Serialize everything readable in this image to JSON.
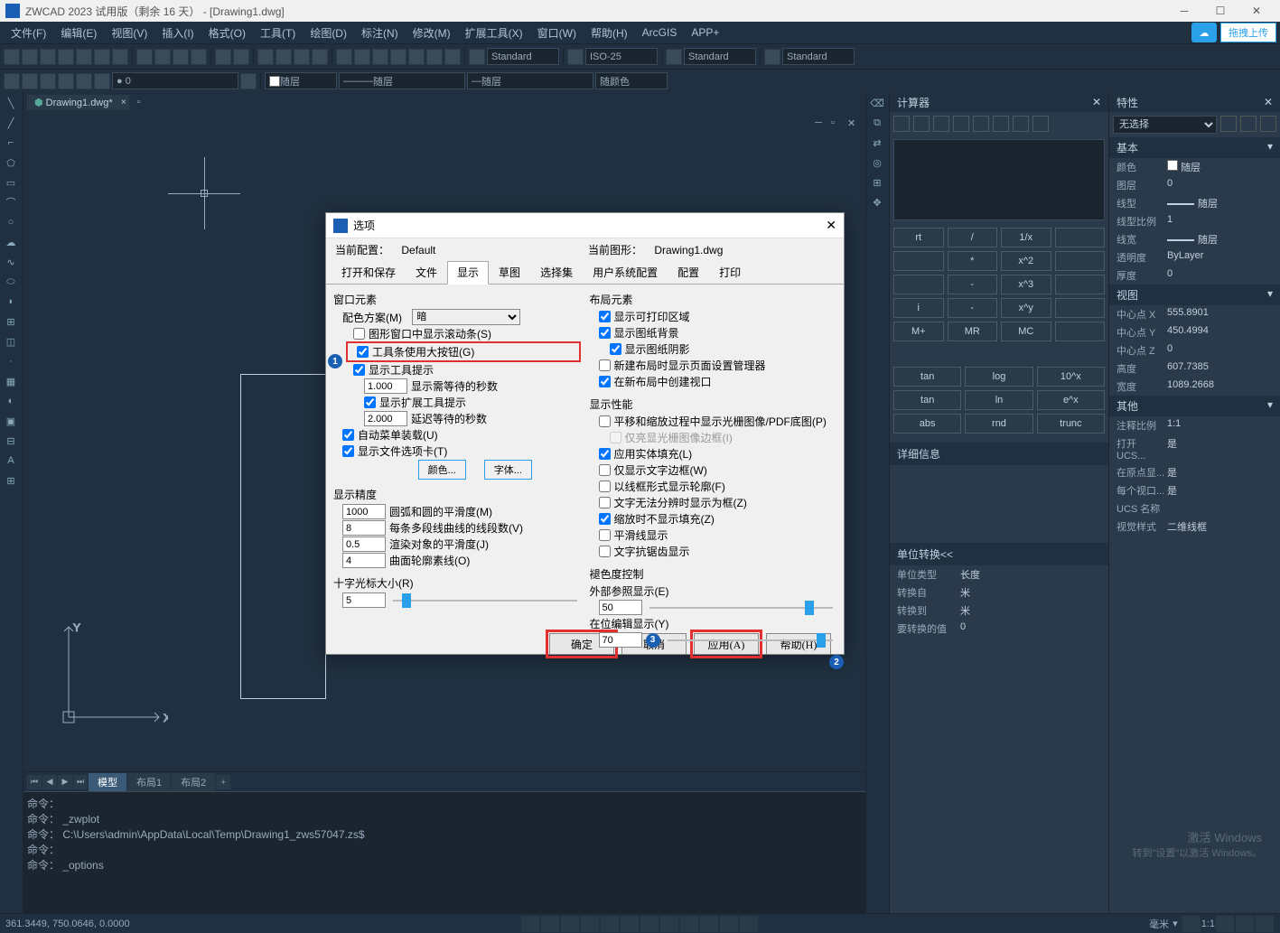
{
  "title": "ZWCAD 2023 试用版（剩余 16 天） - [Drawing1.dwg]",
  "menus": [
    "文件(F)",
    "编辑(E)",
    "视图(V)",
    "插入(I)",
    "格式(O)",
    "工具(T)",
    "绘图(D)",
    "标注(N)",
    "修改(M)",
    "扩展工具(X)",
    "窗口(W)",
    "帮助(H)",
    "ArcGIS",
    "APP+"
  ],
  "upload": {
    "label": "拖拽上传"
  },
  "toolbar": {
    "style1": "Standard",
    "style2": "ISO-25",
    "style3": "Standard",
    "style4": "Standard"
  },
  "layerbar": {
    "l1": "随层",
    "l2": "随层",
    "l3": "随层",
    "l4": "随颜色"
  },
  "docTab": "Drawing1.dwg*",
  "modelTabs": {
    "model": "模型",
    "layout1": "布局1",
    "layout2": "布局2"
  },
  "cmd": {
    "p": "命令：",
    "l1": "命令：",
    "l2": "命令： _zwplot",
    "l3": "命令： C:\\Users\\admin\\AppData\\Local\\Temp\\Drawing1_zws57047.zs$",
    "l4": "命令：",
    "l5": "命令： _options"
  },
  "calc": {
    "title": "计算器",
    "btns": [
      "rt",
      "/",
      "1/x",
      "",
      "",
      "x^2",
      "",
      "",
      "x^3",
      "i",
      "-",
      "x^y",
      "M+",
      "MR",
      "MC"
    ],
    "sci": [
      [
        "tan",
        "log",
        "10^x"
      ],
      [
        "tan",
        "ln",
        "e^x"
      ],
      [
        "abs",
        "rnd",
        "trunc"
      ]
    ],
    "detailTitle": "详细信息",
    "unitTitle": "单位转换<<",
    "unit": {
      "type": {
        "l": "单位类型",
        "v": "长度"
      },
      "from": {
        "l": "转换自",
        "v": "米"
      },
      "to": {
        "l": "转换到",
        "v": "米"
      },
      "val": {
        "l": "要转换的值",
        "v": "0"
      }
    }
  },
  "props": {
    "title": "特性",
    "sel": "无选择",
    "basic": {
      "title": "基本",
      "color": {
        "l": "颜色",
        "v": "随层"
      },
      "layer": {
        "l": "图层",
        "v": "0"
      },
      "ltype": {
        "l": "线型",
        "v": "随层"
      },
      "ltscale": {
        "l": "线型比例",
        "v": "1"
      },
      "lw": {
        "l": "线宽",
        "v": "随层"
      },
      "trans": {
        "l": "透明度",
        "v": "ByLayer"
      },
      "thick": {
        "l": "厚度",
        "v": "0"
      }
    },
    "view": {
      "title": "视图",
      "cx": {
        "l": "中心点 X",
        "v": "555.8901"
      },
      "cy": {
        "l": "中心点 Y",
        "v": "450.4994"
      },
      "cz": {
        "l": "中心点 Z",
        "v": "0"
      },
      "h": {
        "l": "高度",
        "v": "607.7385"
      },
      "w": {
        "l": "宽度",
        "v": "1089.2668"
      }
    },
    "other": {
      "title": "其他",
      "ann": {
        "l": "注释比例",
        "v": "1:1"
      },
      "ucs1": {
        "l": "打开 UCS...",
        "v": "是"
      },
      "ucs2": {
        "l": "在原点显...",
        "v": "是"
      },
      "ucs3": {
        "l": "每个视口...",
        "v": "是"
      },
      "ucsname": {
        "l": "UCS 名称",
        "v": ""
      },
      "vstyle": {
        "l": "视觉样式",
        "v": "二维线框"
      }
    }
  },
  "status": {
    "coords": "361.3449, 750.0646, 0.0000",
    "scale": "毫米",
    "annot": "1:1"
  },
  "watermark": {
    "l1": "激活 Windows",
    "l2": "转到\"设置\"以激活 Windows。"
  },
  "dialog": {
    "title": "选项",
    "profile": {
      "l": "当前配置：",
      "v": "Default"
    },
    "drawing": {
      "l": "当前图形：",
      "v": "Drawing1.dwg"
    },
    "tabs": [
      "打开和保存",
      "文件",
      "显示",
      "草图",
      "选择集",
      "用户系统配置",
      "配置",
      "打印"
    ],
    "left": {
      "win": {
        "title": "窗口元素",
        "scheme": {
          "l": "配色方案(M)",
          "v": "暗"
        },
        "scroll": "图形窗口中显示滚动条(S)",
        "bigbtn": "工具条使用大按钮(G)",
        "tips": "显示工具提示",
        "delay": {
          "v": "1.000",
          "l": "显示需等待的秒数"
        },
        "exttips": "显示扩展工具提示",
        "extdelay": {
          "v": "2.000",
          "l": "延迟等待的秒数"
        },
        "autoload": "自动菜单装载(U)",
        "filetab": "显示文件选项卡(T)",
        "colorbtn": "颜色...",
        "fontbtn": "字体..."
      },
      "prec": {
        "title": "显示精度",
        "arc": {
          "v": "1000",
          "l": "圆弧和圆的平滑度(M)"
        },
        "seg": {
          "v": "8",
          "l": "每条多段线曲线的线段数(V)"
        },
        "render": {
          "v": "0.5",
          "l": "渲染对象的平滑度(J)"
        },
        "surf": {
          "v": "4",
          "l": "曲面轮廓素线(O)"
        }
      },
      "cross": {
        "title": "十字光标大小(R)",
        "v": "5"
      }
    },
    "right": {
      "layout": {
        "title": "布局元素",
        "print": "显示可打印区域",
        "paper": "显示图纸背景",
        "shadow": "显示图纸阴影",
        "newlayout": "新建布局时显示页面设置管理器",
        "vport": "在新布局中创建视口"
      },
      "perf": {
        "title": "显示性能",
        "raster": "平移和缩放过程中显示光栅图像/PDF底图(P)",
        "hilite": "仅亮显光栅图像边框(I)",
        "solid": "应用实体填充(L)",
        "textframe": "仅显示文字边框(W)",
        "wire": "以线框形式显示轮廓(F)",
        "textsplit": "文字无法分辨时显示为框(Z)",
        "zoomfill": "缩放时不显示填充(Z)",
        "smooth": "平滑线显示",
        "aalias": "文字抗锯齿显示"
      },
      "fade": {
        "title": "褪色度控制",
        "ext": {
          "l": "外部参照显示(E)",
          "v": "50"
        },
        "edit": {
          "l": "在位编辑显示(Y)",
          "v": "70"
        }
      }
    },
    "buttons": {
      "ok": "确定",
      "cancel": "取消",
      "apply": "应用(A)",
      "help": "帮助(H)"
    }
  }
}
